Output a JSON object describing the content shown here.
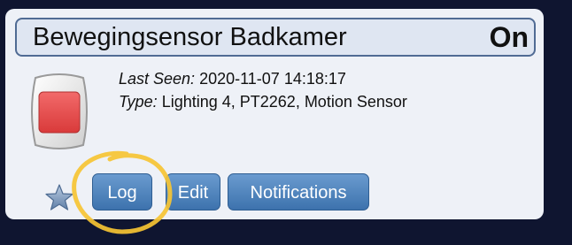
{
  "device": {
    "name": "Bewegingsensor Badkamer",
    "status": "On"
  },
  "info": {
    "last_seen_label": "Last Seen:",
    "last_seen_value": "2020-11-07 14:18:17",
    "type_label": "Type:",
    "type_value": "Lighting 4, PT2262, Motion Sensor"
  },
  "buttons": {
    "log": "Log",
    "edit": "Edit",
    "notifications": "Notifications"
  },
  "icons": {
    "sensor": "motion-sensor-icon",
    "favorite": "star-icon"
  },
  "colors": {
    "background": "#0f1530",
    "card": "#eef1f7",
    "header_border": "#506b94",
    "button": "#3d72ad",
    "sensor_red": "#e84a4a",
    "annotation_circle": "#f6c433"
  }
}
